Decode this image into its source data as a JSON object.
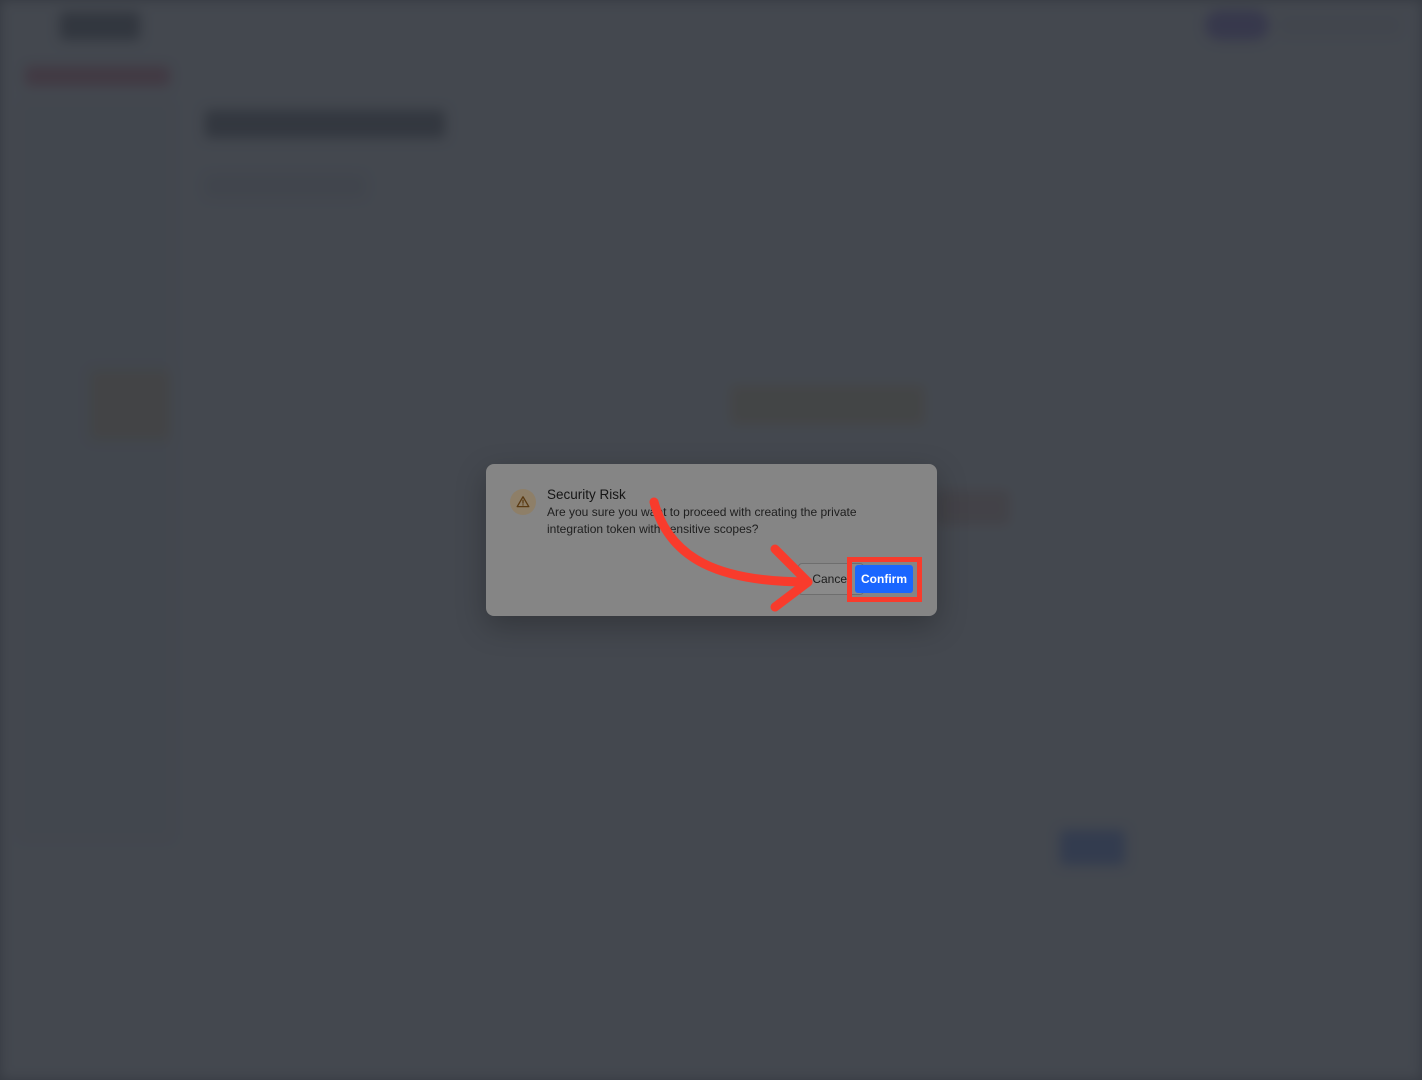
{
  "dialog": {
    "title": "Security Risk",
    "message": "Are you sure you want to proceed with creating the private integration token with sensitive scopes?",
    "cancel_label": "Cancel",
    "confirm_label": "Confirm",
    "icon": "warning-triangle-icon"
  },
  "colors": {
    "confirm_button": "#1a66ff",
    "annotation": "#f83b2c",
    "backdrop": "#41444c"
  }
}
